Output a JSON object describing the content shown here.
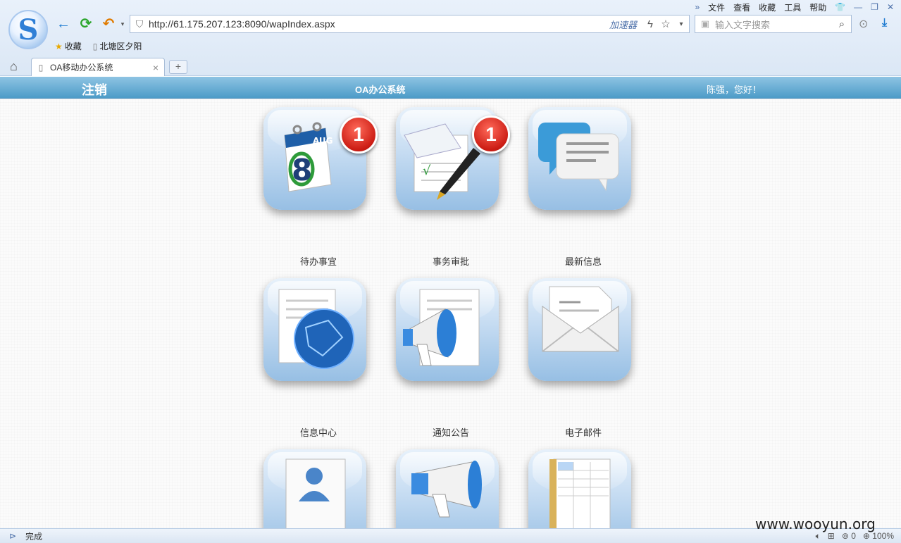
{
  "browser": {
    "menu": {
      "expand": "»",
      "file": "文件",
      "view": "查看",
      "favorites": "收藏",
      "tools": "工具",
      "help": "帮助",
      "skin": "👕",
      "minimize": "—",
      "restore": "❐",
      "close": "✕"
    },
    "address": {
      "url": "http://61.175.207.123:8090/wapIndex.aspx",
      "accelerator": "加速器"
    },
    "search": {
      "placeholder": "输入文字搜索"
    },
    "bookmarks": {
      "favorites": "收藏",
      "item1": "北塘区夕阳"
    },
    "tab": {
      "title": "OA移动办公系统",
      "close": "×",
      "new": "+"
    }
  },
  "page": {
    "logout": "注销",
    "title": "OA办公系统",
    "greeting": "陈强，您好！"
  },
  "apps": [
    {
      "label": "待办事宜",
      "badge": "1",
      "icon": "calendar-icon"
    },
    {
      "label": "事务审批",
      "badge": "1",
      "icon": "document-pen-icon"
    },
    {
      "label": "最新信息",
      "badge": "",
      "icon": "chat-bubbles-icon"
    },
    {
      "label": "信息中心",
      "badge": "",
      "icon": "globe-document-icon"
    },
    {
      "label": "通知公告",
      "badge": "",
      "icon": "megaphone-document-icon"
    },
    {
      "label": "电子邮件",
      "badge": "",
      "icon": "envelope-icon"
    },
    {
      "label": "",
      "badge": "",
      "icon": "contact-card-icon"
    },
    {
      "label": "",
      "badge": "",
      "icon": "megaphone-icon"
    },
    {
      "label": "",
      "badge": "",
      "icon": "spreadsheet-icon"
    }
  ],
  "status": {
    "text": "完成",
    "downloads": "0",
    "zoom": "100%"
  },
  "watermark": "www.wooyun.org",
  "colors": {
    "header_bar": "#4d9cc8",
    "badge_red": "#cc1d14",
    "icon_blue": "#97bfe4"
  }
}
